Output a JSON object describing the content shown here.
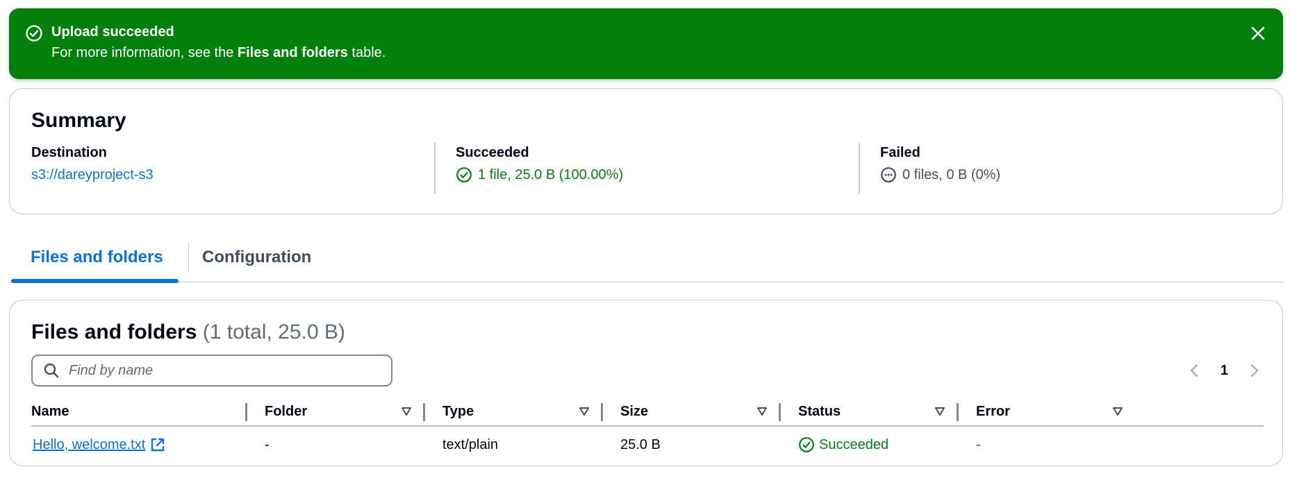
{
  "flash": {
    "title": "Upload succeeded",
    "body_prefix": "For more information, see the ",
    "body_bold": "Files and folders",
    "body_suffix": " table.",
    "icon": "check-circle-icon",
    "close_icon": "close-icon",
    "color": "#037f0c"
  },
  "summary": {
    "title": "Summary",
    "destination": {
      "label": "Destination",
      "value": "s3://dareyproject-s3"
    },
    "succeeded": {
      "label": "Succeeded",
      "value": "1 file, 25.0 B (100.00%)",
      "icon": "check-circle-icon"
    },
    "failed": {
      "label": "Failed",
      "value": "0 files, 0 B (0%)",
      "icon": "pending-circle-icon"
    }
  },
  "tabs": [
    {
      "label": "Files and folders",
      "active": true
    },
    {
      "label": "Configuration",
      "active": false
    }
  ],
  "files": {
    "title": "Files and folders",
    "count": "(1 total, 25.0 B)",
    "search": {
      "placeholder": "Find by name",
      "value": ""
    },
    "pagination": {
      "current": "1"
    },
    "columns": [
      "Name",
      "Folder",
      "Type",
      "Size",
      "Status",
      "Error"
    ],
    "rows": [
      {
        "name": "Hello, welcome.txt",
        "folder": "-",
        "type": "text/plain",
        "size": "25.0 B",
        "status": "Succeeded",
        "error": "-"
      }
    ]
  },
  "colors": {
    "accent": "#0972d3",
    "success": "#037f0c",
    "text": "#000716",
    "border": "#c6c6cd"
  }
}
